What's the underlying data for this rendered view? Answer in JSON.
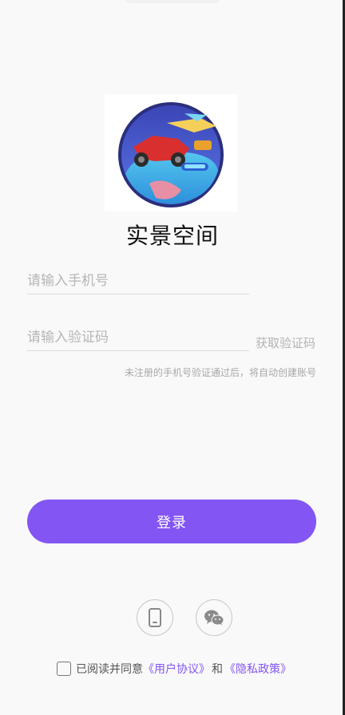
{
  "app": {
    "name": "实景空间"
  },
  "form": {
    "phone_placeholder": "请输入手机号",
    "code_placeholder": "请输入验证码",
    "get_code_label": "获取验证码",
    "hint": "未注册的手机号验证通过后，将自动创建账号"
  },
  "actions": {
    "login_label": "登录",
    "alt_login_icons": [
      "phone-icon",
      "wechat-icon"
    ]
  },
  "agreement": {
    "prefix": "已阅读并同意",
    "user_agreement": "《用户协议》",
    "and": "和",
    "privacy_policy": "《隐私政策》"
  },
  "colors": {
    "accent": "#8355f3",
    "background": "#f9f9f9",
    "placeholder": "#b6b6b6"
  }
}
